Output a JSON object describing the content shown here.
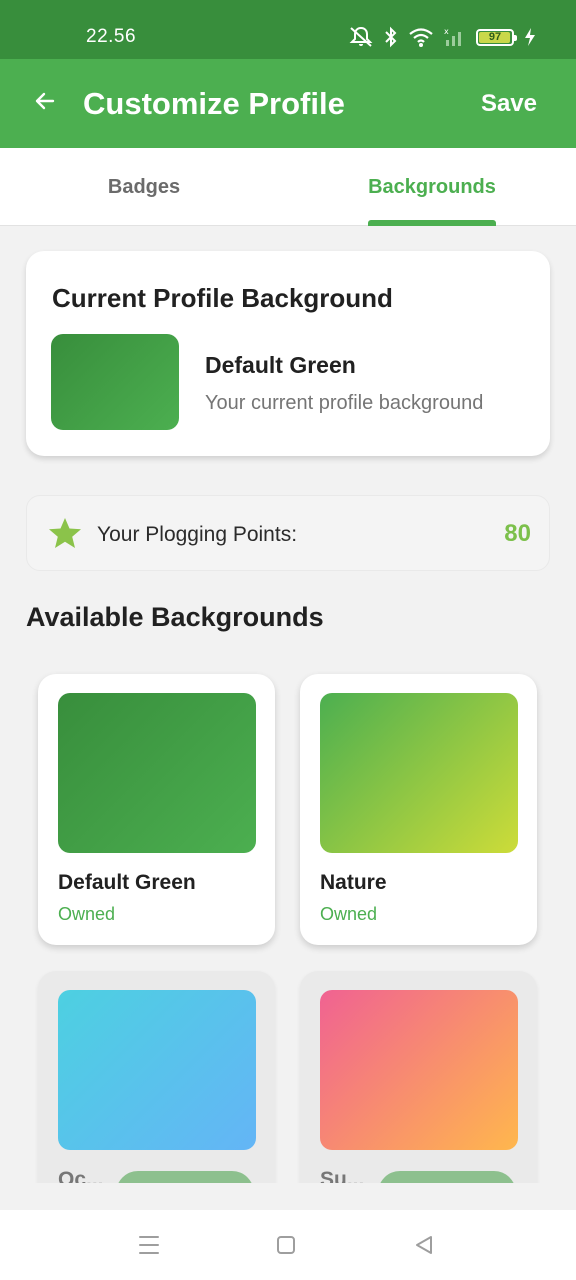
{
  "status_bar": {
    "time": "22.56",
    "battery_level": "97",
    "battery_fraction": 0.97
  },
  "app_bar": {
    "title": "Customize Profile",
    "save_label": "Save",
    "back_icon": "arrow-left-icon",
    "color": "#4caf50",
    "status_color": "#388e3c"
  },
  "tabs": [
    {
      "label": "Badges",
      "selected": false
    },
    {
      "label": "Backgrounds",
      "selected": true
    }
  ],
  "current_background": {
    "section_title": "Current Profile Background",
    "name": "Default Green",
    "description": "Your current profile background"
  },
  "points": {
    "label": "Your Plogging Points:",
    "value": "80",
    "icon": "star-icon",
    "color": "#7cc04b"
  },
  "available": {
    "title": "Available Backgrounds",
    "items": [
      {
        "name": "Default Green",
        "status": "Owned",
        "gradient": [
          "#388e3c",
          "#4caf50"
        ]
      },
      {
        "name": "Nature",
        "status": "Owned",
        "gradient": [
          "#4caf50",
          "#cddc39"
        ]
      },
      {
        "name": "Oc...",
        "status": "",
        "gradient": [
          "#4dd0e1",
          "#64b5f6"
        ]
      },
      {
        "name": "Su...",
        "status": "",
        "gradient": [
          "#f06292",
          "#ffb74d"
        ]
      }
    ]
  },
  "nav_bar": {
    "icons": [
      "menu-icon",
      "home-square-icon",
      "back-triangle-icon"
    ]
  }
}
